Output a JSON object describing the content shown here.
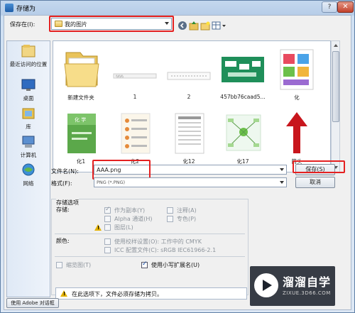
{
  "window": {
    "title": "存储为",
    "help_label": "?",
    "close_label": "✕"
  },
  "location": {
    "label": "保存在(I):",
    "value": "我的图片"
  },
  "places": [
    {
      "label": "最近访问的位置",
      "icon": "recent-places-icon"
    },
    {
      "label": "桌面",
      "icon": "desktop-icon"
    },
    {
      "label": "库",
      "icon": "libraries-icon"
    },
    {
      "label": "计算机",
      "icon": "computer-icon"
    },
    {
      "label": "网络",
      "icon": "network-icon"
    }
  ],
  "files": [
    {
      "name": "新建文件夹",
      "kind": "folder"
    },
    {
      "name": "1",
      "kind": "image"
    },
    {
      "name": "2",
      "kind": "image"
    },
    {
      "name": "457bb76caad5...",
      "kind": "image"
    },
    {
      "name": "化",
      "kind": "image"
    },
    {
      "name": "化1",
      "kind": "image"
    },
    {
      "name": "化2",
      "kind": "image"
    },
    {
      "name": "化12",
      "kind": "image"
    },
    {
      "name": "化17",
      "kind": "image"
    },
    {
      "name": "箭头",
      "kind": "image"
    }
  ],
  "thumb_text": {
    "cover_title": "化 学",
    "file1_text": "\\\\\\\\\\\\\\\\"
  },
  "filename": {
    "label": "文件名(N):",
    "value": "AAA.png"
  },
  "format": {
    "label": "格式(F):",
    "value": "PNG (*.PNG)"
  },
  "buttons": {
    "save": "保存(S)",
    "cancel": "取消",
    "adobe_dialog": "使用 Adobe 对话框"
  },
  "options": {
    "title": "存储选项",
    "storage_label": "存储:",
    "as_copy": "作为副本(Y)",
    "notes": "注释(A)",
    "alpha": "Alpha 通道(H)",
    "spot": "专色(P)",
    "layers": "图层(L)",
    "color_label": "颜色:",
    "proof": "使用校样设置(O): 工作中的 CMYK",
    "icc": "ICC 配置文件(C): sRGB IEC61966-2.1",
    "thumbnail": "缩览图(T)",
    "lowercase_ext": "使用小写扩展名(U)",
    "notice": "在此选项下，文件必须存储为拷贝。"
  },
  "watermark": {
    "brand": "溜溜自学",
    "url": "ZIXUE.3D66.COM"
  },
  "colors": {
    "accent_red": "#e42020",
    "selection_blue": "#1a4fa8"
  }
}
